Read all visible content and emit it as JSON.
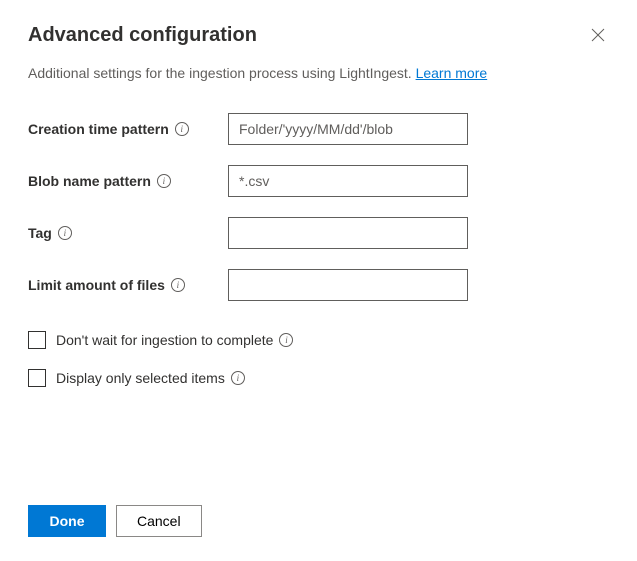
{
  "header": {
    "title": "Advanced configuration"
  },
  "subtitle": {
    "text": "Additional settings for the ingestion process using LightIngest. ",
    "link": "Learn more"
  },
  "fields": {
    "creationTime": {
      "label": "Creation time pattern",
      "placeholder": "Folder/'yyyy/MM/dd'/blob",
      "value": ""
    },
    "blobName": {
      "label": "Blob name pattern",
      "placeholder": "*.csv",
      "value": ""
    },
    "tag": {
      "label": "Tag",
      "placeholder": "",
      "value": ""
    },
    "limitFiles": {
      "label": "Limit amount of files",
      "placeholder": "",
      "value": ""
    }
  },
  "checkboxes": {
    "dontWait": {
      "label": "Don't wait for ingestion to complete"
    },
    "displaySelected": {
      "label": "Display only selected items"
    }
  },
  "footer": {
    "done": "Done",
    "cancel": "Cancel"
  }
}
